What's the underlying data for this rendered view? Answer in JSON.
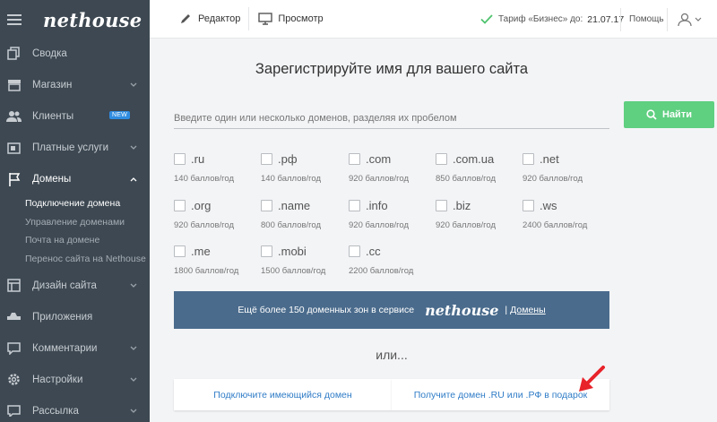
{
  "sidebar": {
    "logo": "nethouse",
    "items": [
      {
        "label": "Сводка",
        "icon": "copy-icon"
      },
      {
        "label": "Магазин",
        "icon": "store-icon"
      },
      {
        "label": "Клиенты",
        "icon": "users-icon",
        "badge": "NEW"
      },
      {
        "label": "Платные услуги",
        "icon": "wallet-icon"
      },
      {
        "label": "Домены",
        "icon": "flag-icon"
      },
      {
        "label": "Дизайн сайта",
        "icon": "layout-icon"
      },
      {
        "label": "Приложения",
        "icon": "puzzle-icon"
      },
      {
        "label": "Комментарии",
        "icon": "comment-icon"
      },
      {
        "label": "Настройки",
        "icon": "gear-icon"
      },
      {
        "label": "Рассылка",
        "icon": "mail-icon"
      }
    ],
    "domains_sub": [
      "Подключение домена",
      "Управление доменами",
      "Почта на домене",
      "Перенос сайта на Nethouse"
    ]
  },
  "topbar": {
    "editor": "Редактор",
    "preview": "Просмотр",
    "tariff_label": "Тариф «Бизнес» до:",
    "tariff_date": "21.07.17",
    "help": "Помощь"
  },
  "main": {
    "title": "Зарегистрируйте имя для вашего сайта",
    "search_placeholder": "Введите один или несколько доменов, разделяя их пробелом",
    "find_button": "Найти",
    "domains": [
      {
        "zone": ".ru",
        "price": "140 баллов/год"
      },
      {
        "zone": ".рф",
        "price": "140 баллов/год"
      },
      {
        "zone": ".com",
        "price": "920 баллов/год"
      },
      {
        "zone": ".com.ua",
        "price": "850 баллов/год"
      },
      {
        "zone": ".net",
        "price": "920 баллов/год"
      },
      {
        "zone": ".org",
        "price": "920 баллов/год"
      },
      {
        "zone": ".name",
        "price": "800 баллов/год"
      },
      {
        "zone": ".info",
        "price": "920 баллов/год"
      },
      {
        "zone": ".biz",
        "price": "920 баллов/год"
      },
      {
        "zone": ".ws",
        "price": "2400 баллов/год"
      },
      {
        "zone": ".me",
        "price": "1800 баллов/год"
      },
      {
        "zone": ".mobi",
        "price": "1500 баллов/год"
      },
      {
        "zone": ".cc",
        "price": "2200 баллов/год"
      }
    ],
    "promo_text": "Ещё более 150 доменных зон в сервисе",
    "promo_logo": "nethouse",
    "promo_pipe": "|",
    "promo_link": "Домены",
    "or_text": "или...",
    "connect_button": "Подключите имеющийся домен",
    "gift_button": "Получите домен .RU или .РФ в подарок"
  },
  "colors": {
    "sidebar_bg": "#3d4852",
    "accent_green": "#5fcf80",
    "promo_bg": "#4a6b8c",
    "link_blue": "#2f7cc7",
    "arrow_red": "#e8232a"
  }
}
